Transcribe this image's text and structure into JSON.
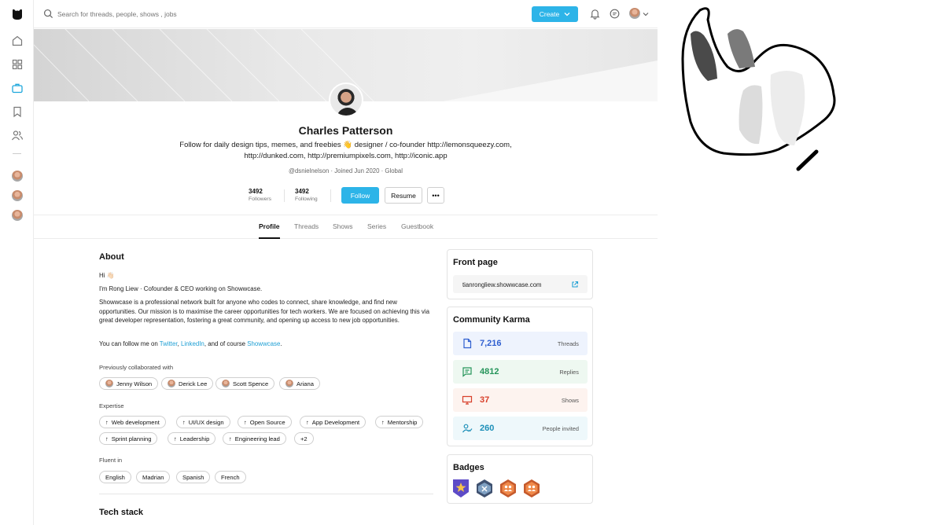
{
  "search": {
    "placeholder": "Search for threads, people, shows , jobs"
  },
  "topbar": {
    "create_label": "Create"
  },
  "profile": {
    "name": "Charles Patterson",
    "bio_line1": "Follow for daily design tips, memes, and freebies 👋 designer / co-founder http://lemonsqueezy.com,",
    "bio_line2": "http://dunked.com, http://premiumpixels.com, http://iconic.app",
    "meta": "@dsnielnelson · Joined Jun 2020 · Global",
    "followers_count": "3492",
    "followers_label": "Followers",
    "following_count": "3492",
    "following_label": "Following",
    "follow_label": "Follow",
    "resume_label": "Resume",
    "more_label": "•••"
  },
  "tabs": [
    "Profile",
    "Threads",
    "Shows",
    "Series",
    "Guestbook"
  ],
  "about": {
    "title": "About",
    "hi": "Hi 👋🏻",
    "intro": "I'm Rong Liew · Cofounder & CEO working on Showwcase.",
    "para": "Showwcase is a professional network built for anyone who codes to connect, share knowledge, and find new opportunities. Our mission is to maximise the career opportunities for tech workers. We are focused on achieving this via great developer representation, fostering a great community, and opening up access to new job opportunities.",
    "follow_prefix": "You can follow me on ",
    "twitter": "Twitter",
    "sep": ", ",
    "linkedin": "LinkedIn",
    "and_course": ", and of course ",
    "showwcase": "Showwcase",
    "end": "."
  },
  "collab": {
    "label": "Previously collaborated with",
    "people": [
      "Jenny Wilson",
      "Derick Lee",
      "Scott Spence",
      "Ariana"
    ]
  },
  "expertise": {
    "label": "Expertise",
    "items": [
      "Web development",
      "UI/UX design",
      "Open Source",
      "App Development",
      "Mentorship",
      "Sprint planning",
      "Leadership",
      "Engineering lead"
    ],
    "more": "+2"
  },
  "fluent": {
    "label": "Fluent in",
    "items": [
      "English",
      "Madrian",
      "Spanish",
      "French"
    ]
  },
  "tech": {
    "title": "Tech stack"
  },
  "front_page": {
    "title": "Front page",
    "url": "tianrongliew.showwcase.com"
  },
  "karma": {
    "title": "Community Karma",
    "rows": [
      {
        "value": "7,216",
        "label": "Threads",
        "color": "#2f5fd0",
        "bg": "#eef3fd"
      },
      {
        "value": "4812",
        "label": "Replies",
        "color": "#25945a",
        "bg": "#eef8f1"
      },
      {
        "value": "37",
        "label": "Shows",
        "color": "#d8402b",
        "bg": "#fdf3ef"
      },
      {
        "value": "260",
        "label": "People invited",
        "color": "#1c8fb8",
        "bg": "#eef8fb"
      }
    ]
  },
  "badges": {
    "title": "Badges",
    "items": [
      "star-badge",
      "cross-badge",
      "people-badge",
      "people-badge"
    ]
  },
  "colors": {
    "accent": "#2db4e8"
  }
}
